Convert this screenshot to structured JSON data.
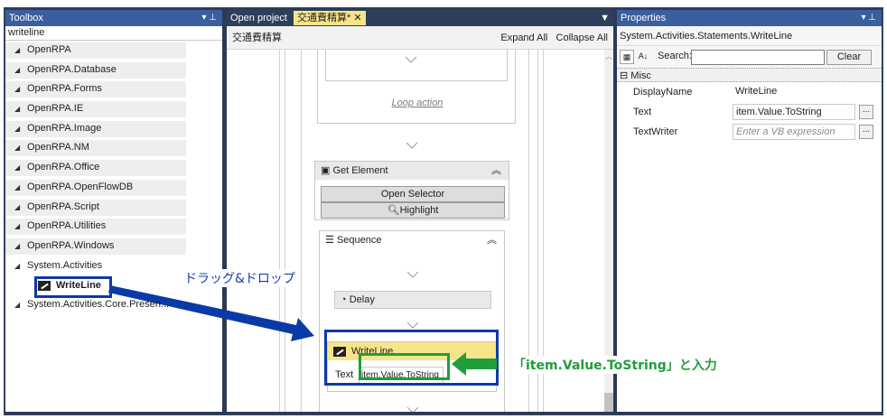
{
  "toolbox": {
    "title": "Toolbox",
    "search_value": "writeline",
    "categories": [
      "OpenRPA",
      "OpenRPA.Database",
      "OpenRPA.Forms",
      "OpenRPA.IE",
      "OpenRPA.Image",
      "OpenRPA.NM",
      "OpenRPA.Office",
      "OpenRPA.OpenFlowDB",
      "OpenRPA.Script",
      "OpenRPA.Utilities",
      "OpenRPA.Windows",
      "System.Activities"
    ],
    "child_item": "WriteLine",
    "last_category": "System.Activities.Core.Presen..."
  },
  "designer": {
    "tab_open_project": "Open project",
    "tab_active": "交通費精算*",
    "workflow_name": "交通費精算",
    "expand_all": "Expand All",
    "collapse_all": "Collapse All",
    "loop_action": "Loop action",
    "get_element": "Get Element",
    "open_selector": "Open Selector",
    "highlight": "Highlight",
    "sequence": "Sequence",
    "delay": "Delay",
    "writeline": "WriteLine",
    "text_label": "Text",
    "text_value": "item.Value.ToString"
  },
  "properties": {
    "title": "Properties",
    "type_name": "System.Activities.Statements.WriteLine",
    "search_label": "Search:",
    "clear_label": "Clear",
    "category": "Misc",
    "rows": [
      {
        "name": "DisplayName",
        "value": "WriteLine"
      },
      {
        "name": "Text",
        "value": "item.Value.ToString"
      },
      {
        "name": "TextWriter",
        "value": "Enter a VB expression"
      }
    ]
  },
  "annotations": {
    "drag_drop": "ドラッグ&ドロップ",
    "input_note": "「item.Value.ToString」と入力"
  },
  "colors": {
    "title_bar": "#3b5e9e",
    "highlight_box": "#0a3aa8",
    "green": "#1f9e3a",
    "active_tab": "#f7e48a"
  }
}
